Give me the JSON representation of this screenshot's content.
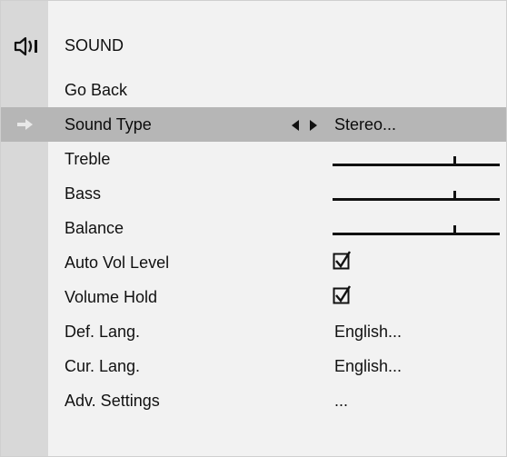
{
  "menu": {
    "title": "SOUND",
    "items": [
      {
        "label": "Go Back",
        "value": ""
      },
      {
        "label": "Sound Type",
        "value": "Stereo...",
        "selected": true
      },
      {
        "label": "Treble",
        "slider": 0.73
      },
      {
        "label": "Bass",
        "slider": 0.73
      },
      {
        "label": "Balance",
        "slider": 0.73
      },
      {
        "label": "Auto Vol Level",
        "checked": true
      },
      {
        "label": "Volume Hold",
        "checked": true
      },
      {
        "label": "Def. Lang.",
        "value": "English..."
      },
      {
        "label": "Cur. Lang.",
        "value": "English..."
      },
      {
        "label": "Adv. Settings",
        "value": "..."
      }
    ]
  },
  "icons": {
    "header": "speaker-icon",
    "selected_row": "right-arrow-icon",
    "value_selector": "left-right-arrows-icon",
    "checkbox": "checkbox-checked-icon"
  },
  "colors": {
    "panel": "#f2f2f2",
    "sidebar": "#d8d8d8",
    "selected_row": "#b6b6b6",
    "text": "#111111"
  }
}
